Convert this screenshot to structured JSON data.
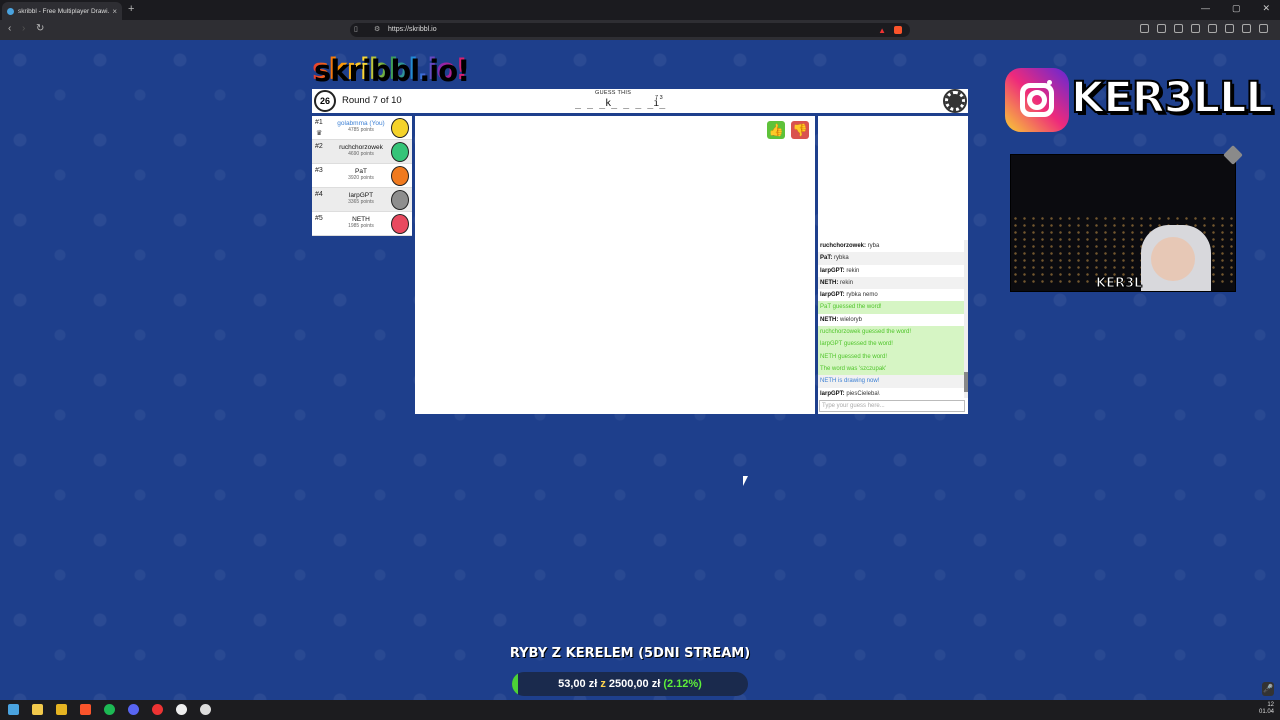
{
  "browser": {
    "tab_title": "skribbl - Free Multiplayer Drawi...",
    "tab_close": "×",
    "new_tab": "+",
    "url": "https://skribbl.io",
    "nav_back": "‹",
    "nav_forward": "›",
    "nav_reload": "↻",
    "win_min": "—",
    "win_max": "▢",
    "win_close": "✕"
  },
  "game": {
    "logo": "skribbl.io!",
    "timer": "26",
    "round": "Round 7 of 10",
    "guess_label": "GUESS THIS",
    "word_pattern": "_ _ _k_ _ _  _i_",
    "word_lengths": "7 3"
  },
  "players": [
    {
      "rank": "#1",
      "name": "golabmma (You)",
      "points": "4785 points",
      "you": true,
      "avatar": "yellow"
    },
    {
      "rank": "#2",
      "name": "ruchchorzowek",
      "points": "4690 points",
      "you": false,
      "avatar": "green"
    },
    {
      "rank": "#3",
      "name": "PaT",
      "points": "3920 points",
      "you": false,
      "avatar": "orange"
    },
    {
      "rank": "#4",
      "name": "larpGPT",
      "points": "3365 points",
      "you": false,
      "avatar": "grey"
    },
    {
      "rank": "#5",
      "name": "NETH",
      "points": "1985 points",
      "you": false,
      "avatar": "red"
    }
  ],
  "chat": {
    "messages": [
      {
        "user": "ruchchorzowek:",
        "text": " ryba",
        "kind": "msg"
      },
      {
        "user": "PaT:",
        "text": " rybka",
        "kind": "msg"
      },
      {
        "user": "larpGPT:",
        "text": " rekin",
        "kind": "msg"
      },
      {
        "user": "NETH:",
        "text": " rekin",
        "kind": "msg"
      },
      {
        "user": "larpGPT:",
        "text": " rybka nemo",
        "kind": "msg"
      },
      {
        "user": "",
        "text": "PaT guessed the word!",
        "kind": "ok"
      },
      {
        "user": "NETH:",
        "text": " wieloryb",
        "kind": "msg"
      },
      {
        "user": "",
        "text": "ruchchorzowek guessed the word!",
        "kind": "ok"
      },
      {
        "user": "",
        "text": "larpGPT guessed the word!",
        "kind": "ok"
      },
      {
        "user": "",
        "text": "NETH guessed the word!",
        "kind": "ok"
      },
      {
        "user": "",
        "text": "The word was 'szczupak'",
        "kind": "ok"
      },
      {
        "user": "",
        "text": "NETH is drawing now!",
        "kind": "draw"
      },
      {
        "user": "larpGPT:",
        "text": " piesCieleba\\",
        "kind": "msg"
      }
    ],
    "input_placeholder": "Type your guess here..."
  },
  "overlay": {
    "instagram_name": "KER3LLL",
    "cam_label": "KER3L",
    "goal_title": "RYBY Z KERELEM (5DNI STREAM)",
    "goal_amount": "53,00 zł",
    "goal_sep": "z",
    "goal_target": "2500,00 zł",
    "goal_percent": "(2.12%)",
    "goal_fraction": 0.0212
  },
  "taskbar": {
    "time": "12",
    "date": "01.04"
  },
  "colors": {
    "accent_blue": "#3b7fd4",
    "correct_green": "#4fc52a",
    "background": "#1e3f8c"
  }
}
